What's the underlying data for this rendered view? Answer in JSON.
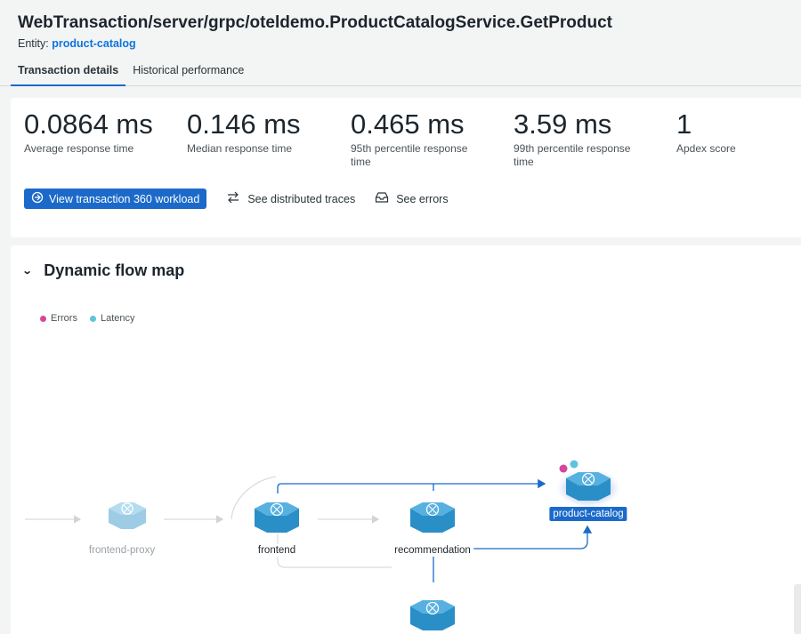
{
  "header": {
    "title": "WebTransaction/server/grpc/oteldemo.ProductCatalogService.GetProduct",
    "entity_label": "Entity:",
    "entity_name": "product-catalog"
  },
  "tabs": [
    {
      "label": "Transaction details",
      "active": true
    },
    {
      "label": "Historical performance",
      "active": false
    }
  ],
  "metrics": [
    {
      "value": "0.0864 ms",
      "label": "Average response time"
    },
    {
      "value": "0.146 ms",
      "label": "Median response time"
    },
    {
      "value": "0.465 ms",
      "label": "95th percentile response time"
    },
    {
      "value": "3.59 ms",
      "label": "99th percentile response time"
    },
    {
      "value": "1",
      "label": "Apdex score"
    }
  ],
  "actions": {
    "workload_label": "View transaction 360 workload",
    "traces_label": "See distributed traces",
    "errors_label": "See errors"
  },
  "flow_map": {
    "title": "Dynamic flow map",
    "legend": [
      {
        "label": "Errors",
        "color": "#d6479c"
      },
      {
        "label": "Latency",
        "color": "#5ec3e0"
      }
    ],
    "nodes": {
      "frontend_proxy": "frontend-proxy",
      "frontend": "frontend",
      "recommendation": "recommendation",
      "product_catalog": "product-catalog"
    }
  },
  "colors": {
    "accent": "#1b6ac9",
    "node": "#2a8fc7",
    "edge": "#1b6ac9"
  }
}
